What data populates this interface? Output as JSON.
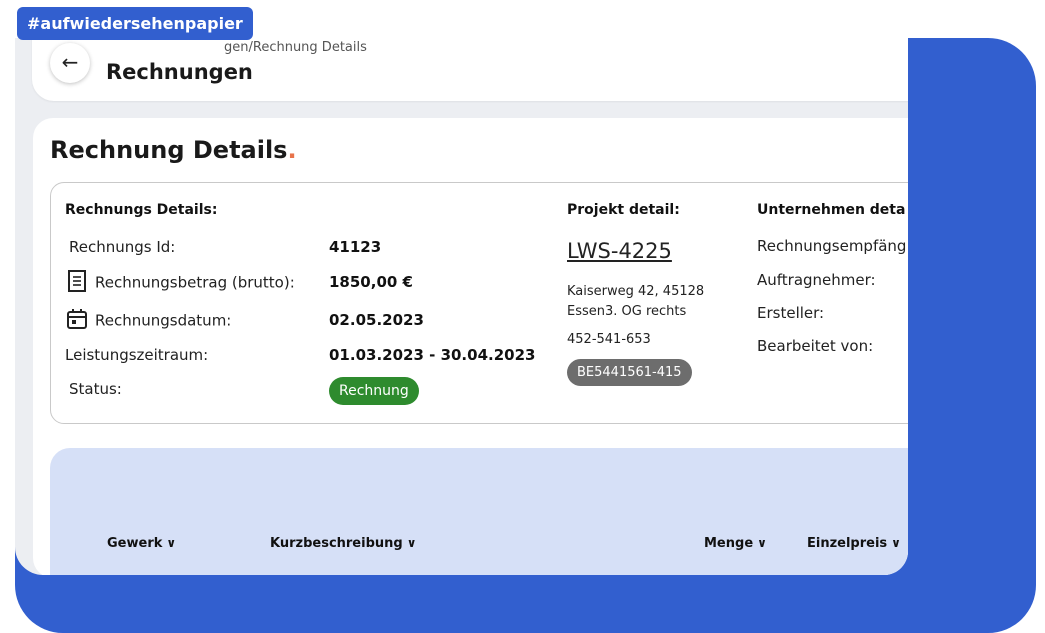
{
  "tag": "#aufwiedersehenpapier",
  "header": {
    "breadcrumb": "gen/Rechnung Details",
    "title": "Rechnungen",
    "back_icon": "arrow-left-icon"
  },
  "card": {
    "title": "Rechnung Details",
    "title_dot": "."
  },
  "rechnung": {
    "heading": "Rechnungs Details:",
    "rows": [
      {
        "label": "Rechnungs Id:",
        "value": "41123",
        "icon": ""
      },
      {
        "label": "Rechnungsbetrag (brutto):",
        "value": "1850,00 €",
        "icon": "receipt-icon"
      },
      {
        "label": "Rechnungsdatum:",
        "value": "02.05.2023",
        "icon": "calendar-icon"
      },
      {
        "label": "Leistungszeitraum:",
        "value": "01.03.2023 - 30.04.2023",
        "icon": ""
      },
      {
        "label": "Status:",
        "value": "Rechnung",
        "icon": ""
      }
    ]
  },
  "projekt": {
    "heading": "Projekt detail:",
    "link": "LWS-4225",
    "address_line1": "Kaiserweg 42, 45128",
    "address_line2": "Essen3. OG rechts",
    "phone": "452-541-653",
    "badge": "BE5441561-415"
  },
  "unternehmen": {
    "heading": "Unternehmen deta",
    "labels": [
      "Rechnungsempfäng",
      "Auftragnehmer:",
      "Ersteller:",
      "Bearbeitet von:"
    ]
  },
  "table": {
    "columns": [
      "Gewerk",
      "Kurzbeschreibung",
      "Menge",
      "Einzelpreis"
    ]
  },
  "colors": {
    "brand_blue": "#325fcf",
    "status_green": "#2e8b2e",
    "accent_orange": "#e8734a",
    "table_bg": "#d6e0f7"
  }
}
